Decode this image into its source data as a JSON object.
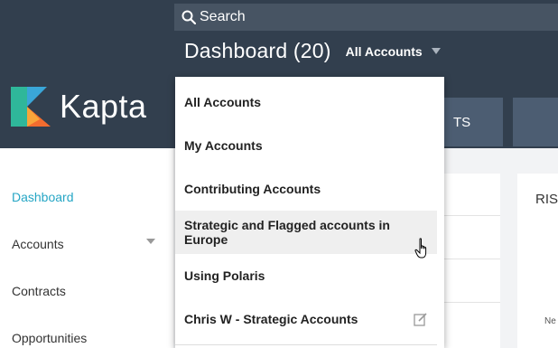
{
  "header": {
    "search_label": "Search",
    "page_title": "Dashboard (20)",
    "account_filter": "All Accounts",
    "logo_text": "Kapta",
    "tabs": [
      "TS",
      ""
    ]
  },
  "sidebar": {
    "items": [
      {
        "label": "Dashboard",
        "active": true
      },
      {
        "label": "Accounts",
        "has_submenu": true
      },
      {
        "label": "Contracts"
      },
      {
        "label": "Opportunities"
      }
    ]
  },
  "dropdown": {
    "items": [
      {
        "label": "All Accounts"
      },
      {
        "label": "My Accounts"
      },
      {
        "label": "Contributing Accounts"
      },
      {
        "label": "Strategic and Flagged accounts in Europe",
        "hovered": true
      },
      {
        "label": "Using Polaris"
      },
      {
        "label": "Chris W - Strategic Accounts",
        "editable": true
      }
    ]
  },
  "content": {
    "risk_card_title": "RIS",
    "risk_card_note": "Ne"
  },
  "colors": {
    "header_bg": "#323f4e",
    "accent": "#26a6c5",
    "tab_bg": "#4c5d72"
  },
  "icons": {
    "search": "search-icon",
    "logo": "kapta-logo-icon",
    "edit": "edit-icon",
    "cursor": "hand-cursor-icon"
  }
}
